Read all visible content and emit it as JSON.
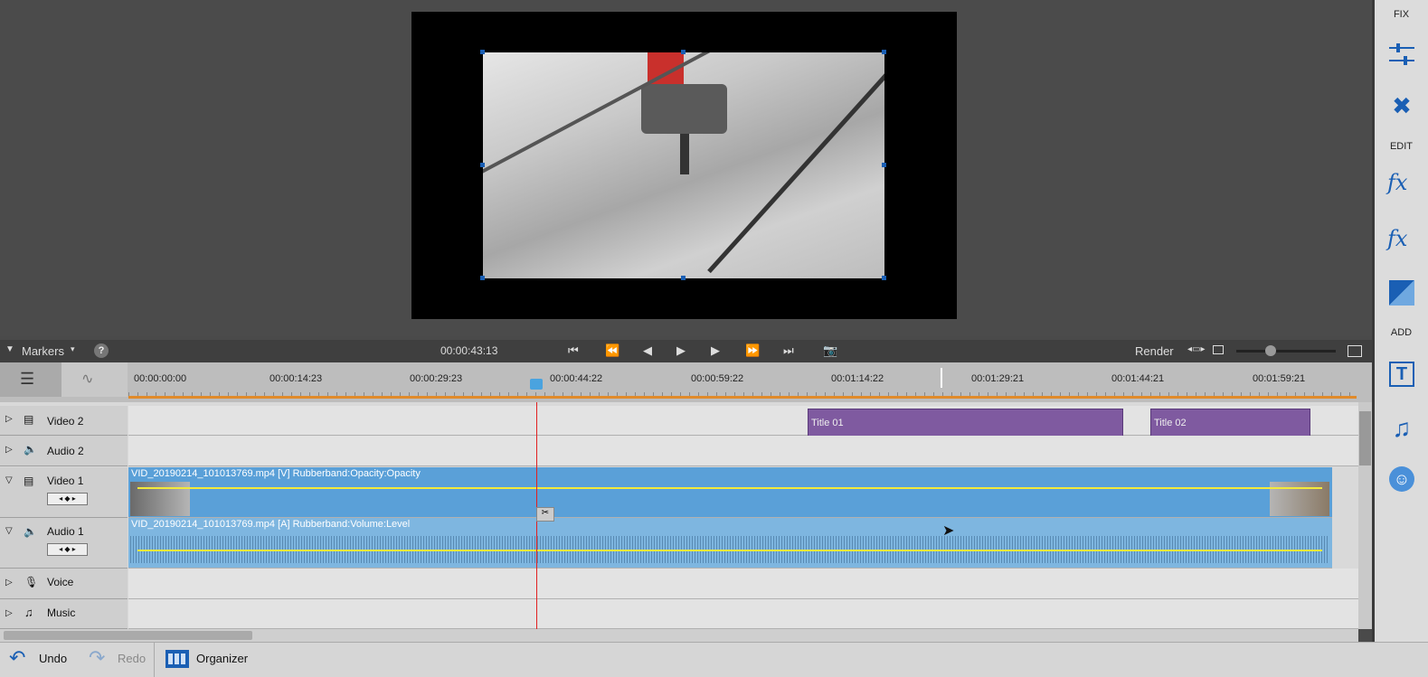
{
  "transport": {
    "markers_label": "Markers",
    "help_label": "?",
    "timecode": "00:00:43:13",
    "render_label": "Render"
  },
  "ruler": {
    "ticks": [
      "00:00:00:00",
      "00:00:14:23",
      "00:00:29:23",
      "00:00:44:22",
      "00:00:59:22",
      "00:01:14:22",
      "00:01:29:21",
      "00:01:44:21",
      "00:01:59:21"
    ]
  },
  "tracks": {
    "video2": {
      "name": "Video 2",
      "clips": [
        "Title 01",
        "Title 02"
      ]
    },
    "audio2": {
      "name": "Audio 2"
    },
    "video1": {
      "name": "Video 1",
      "clip": "VID_20190214_101013769.mp4 [V] Rubberband:Opacity:Opacity"
    },
    "audio1": {
      "name": "Audio 1",
      "clip": "VID_20190214_101013769.mp4 [A] Rubberband:Volume:Level"
    },
    "voice": {
      "name": "Voice"
    },
    "music": {
      "name": "Music"
    }
  },
  "right_panel": {
    "fix_label": "FIX",
    "edit_label": "EDIT",
    "add_label": "ADD"
  },
  "statusbar": {
    "undo": "Undo",
    "redo": "Redo",
    "organizer": "Organizer"
  },
  "colors": {
    "title_clip": "#7f5aa0",
    "video_clip": "#5aa0d8",
    "audio_clip": "#7eb6e0",
    "playhead": "#e22020"
  }
}
